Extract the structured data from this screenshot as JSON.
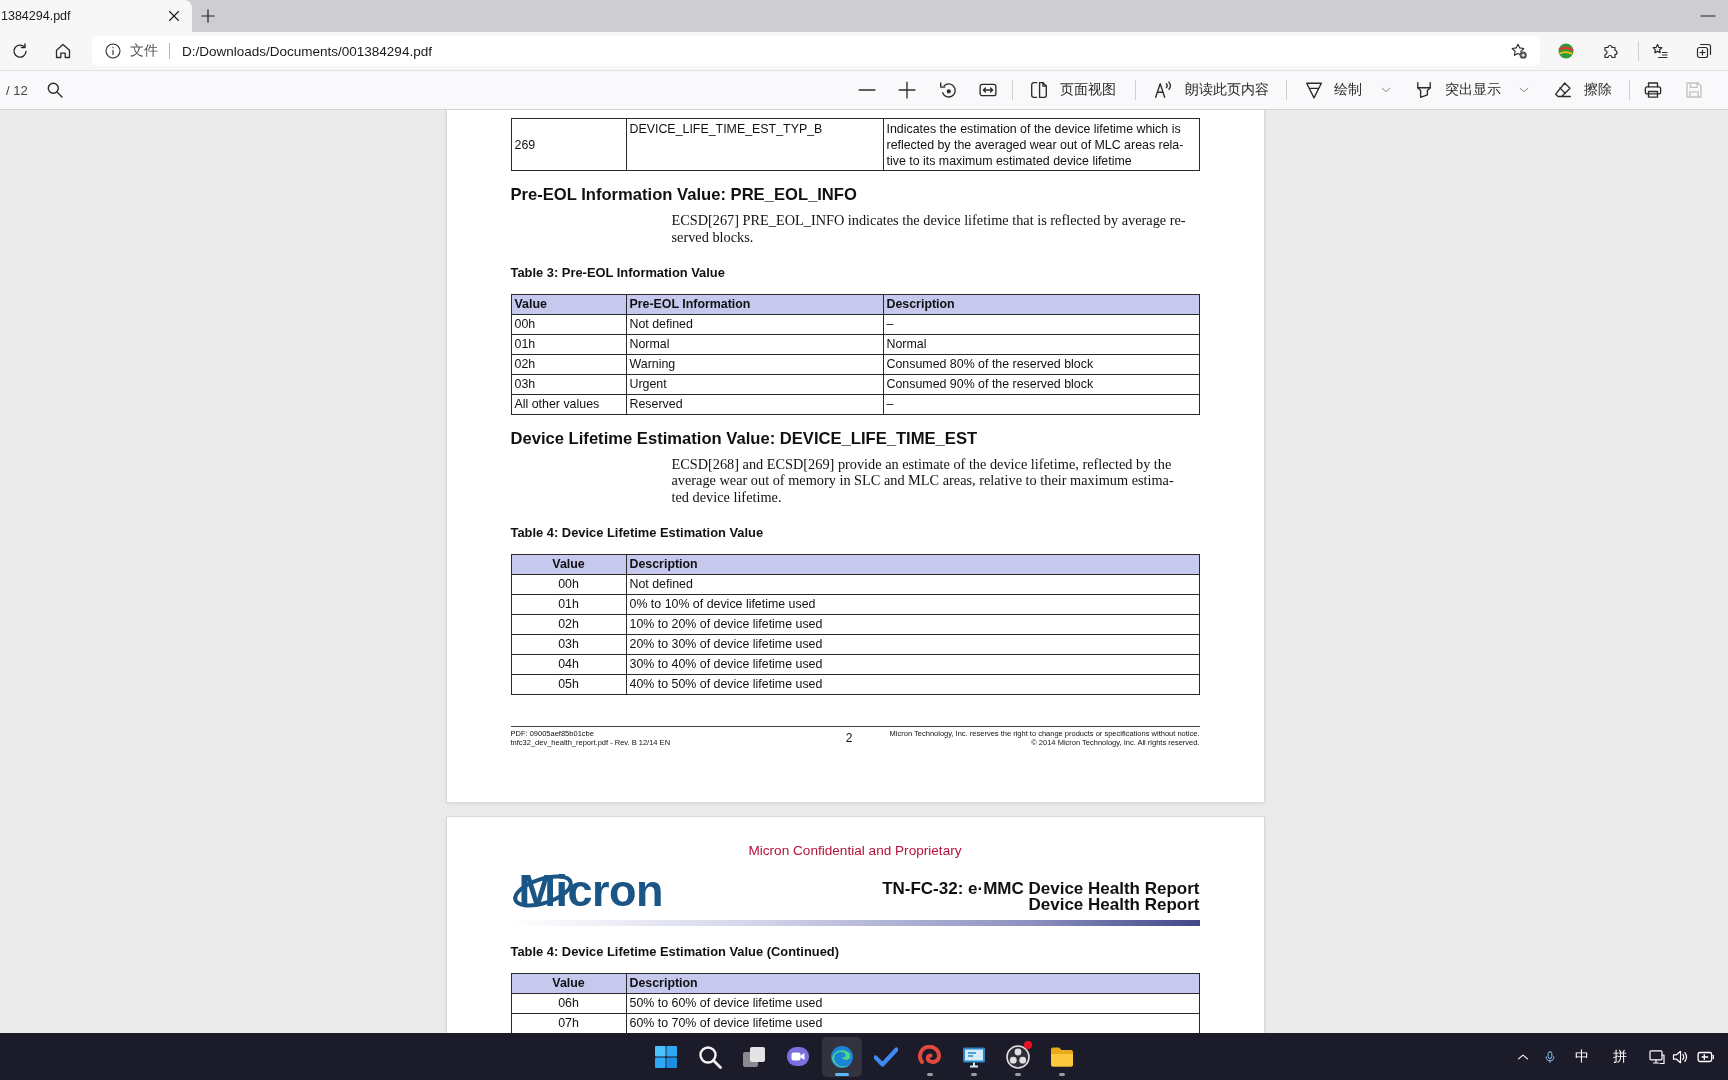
{
  "tab": {
    "title": "1384294.pdf"
  },
  "address_bar": {
    "scheme_label": "文件",
    "url": "D:/Downloads/Documents/001384294.pdf"
  },
  "pdf_toolbar": {
    "page_total": "/ 12",
    "page_view": "页面视图",
    "read_aloud": "朗读此页内容",
    "draw": "绘制",
    "highlight": "突出显示",
    "erase": "擦除",
    "save": {
      "disabled": true
    }
  },
  "pages": [
    {
      "blocks": [
        {
          "kind": "table",
          "rows": [
            [
              "269",
              "DEVICE_LIFE_TIME_EST_TYP_B",
              "Indicates the estimation of the device lifetime which is\nreflected by the averaged wear out of MLC areas rela-\ntive to its maximum estimated device lifetime"
            ]
          ]
        },
        {
          "kind": "heading",
          "text": "Pre-EOL Information Value: PRE_EOL_INFO"
        },
        {
          "kind": "paragraph",
          "text": "ECSD[267] PRE_EOL_INFO indicates the device lifetime that is reflected by average re-\nserved blocks."
        },
        {
          "kind": "caption",
          "text": "Table 3: Pre-EOL Information Value"
        },
        {
          "kind": "table",
          "columns": [
            {
              "label": "Value",
              "centered": false
            },
            {
              "label": "Pre-EOL Information",
              "centered": false
            },
            {
              "label": "Description",
              "centered": false
            }
          ],
          "rows": [
            [
              "00h",
              "Not defined",
              "–"
            ],
            [
              "01h",
              "Normal",
              "Normal"
            ],
            [
              "02h",
              "Warning",
              "Consumed 80% of the reserved block"
            ],
            [
              "03h",
              "Urgent",
              "Consumed 90% of the reserved block"
            ],
            [
              "All other values",
              "Reserved",
              "–"
            ]
          ]
        },
        {
          "kind": "heading",
          "text": "Device Lifetime Estimation Value: DEVICE_LIFE_TIME_EST"
        },
        {
          "kind": "paragraph",
          "text": "ECSD[268] and ECSD[269] provide an estimate of the device lifetime, reflected by the\naverage wear out of memory in SLC and MLC areas, relative to their maximum estima-\nted device lifetime."
        },
        {
          "kind": "caption",
          "text": "Table 4: Device Lifetime Estimation Value"
        },
        {
          "kind": "table",
          "columns": [
            {
              "label": "Value",
              "centered": true
            },
            {
              "label": "Description",
              "centered": false
            }
          ],
          "rows": [
            [
              "00h",
              "Not defined"
            ],
            [
              "01h",
              "0% to 10% of device lifetime used"
            ],
            [
              "02h",
              "10% to 20% of device lifetime used"
            ],
            [
              "03h",
              "20% to 30% of device lifetime used"
            ],
            [
              "04h",
              "30% to 40% of device lifetime used"
            ],
            [
              "05h",
              "40% to 50% of device lifetime used"
            ]
          ]
        }
      ],
      "footer": {
        "left": [
          "PDF: 09005aef85b01cbe",
          "tnfc32_dev_health_report.pdf - Rev. B 12/14 EN"
        ],
        "page_number": "2",
        "right": [
          "Micron Technology, Inc. reserves the right to change products or specifications without notice.",
          "© 2014 Micron Technology, Inc. All rights reserved."
        ]
      }
    },
    {
      "header": {
        "notice": "Micron Confidential and Proprietary",
        "logo": "Micron",
        "title": [
          "TN-FC-32: e·MMC Device Health Report",
          "Device Health Report"
        ]
      },
      "blocks": [
        {
          "kind": "caption",
          "text": "Table 4: Device Lifetime Estimation Value (Continued)"
        },
        {
          "kind": "table",
          "columns": [
            {
              "label": "Value",
              "centered": true
            },
            {
              "label": "Description",
              "centered": false
            }
          ],
          "rows": [
            [
              "06h",
              "50% to 60% of device lifetime used"
            ],
            [
              "07h",
              "60% to 70% of device lifetime used"
            ]
          ]
        }
      ]
    }
  ],
  "taskbar": {
    "apps": [
      {
        "selected": false,
        "running": false,
        "badge": false
      },
      {
        "selected": false,
        "running": false,
        "badge": false
      },
      {
        "selected": false,
        "running": false,
        "badge": false
      },
      {
        "selected": false,
        "running": false,
        "badge": false
      },
      {
        "selected": true,
        "running": true,
        "badge": false
      },
      {
        "selected": false,
        "running": false,
        "badge": false
      },
      {
        "selected": false,
        "running": true,
        "badge": false
      },
      {
        "selected": false,
        "running": true,
        "badge": false
      },
      {
        "selected": false,
        "running": true,
        "badge": true
      },
      {
        "selected": false,
        "running": true,
        "badge": false
      }
    ],
    "tray": {
      "input_language": "中",
      "input_method": "拼"
    }
  }
}
